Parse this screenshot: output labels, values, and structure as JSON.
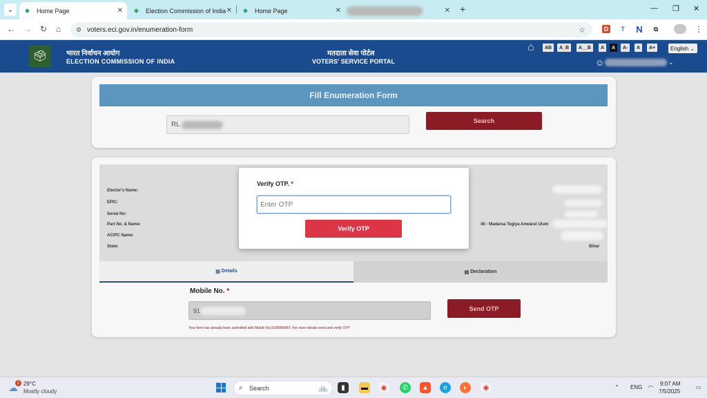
{
  "browser": {
    "tabs": [
      {
        "title": "Home Page",
        "active": true
      },
      {
        "title": "Election Commission of India",
        "active": false
      },
      {
        "title": "Home Page",
        "active": false
      }
    ],
    "url": "voters.eci.gov.in/enumeration-form"
  },
  "site_header": {
    "org_hindi": "भारत निर्वाचन आयोग",
    "org_english": "ELECTION COMMISSION OF INDIA",
    "portal_hindi": "मतदाता सेवा पोर्टल",
    "portal_english": "VOTERS' SERVICE PORTAL",
    "accessibility": [
      "AB",
      "A_B",
      "A__B",
      "A",
      "A",
      "A-",
      "A",
      "A+"
    ],
    "language": "English"
  },
  "form": {
    "title": "Fill Enumeration Form",
    "epic_value": "RL",
    "search_label": "Search",
    "fields": [
      "Elector's Name:",
      "EPIC:",
      "Serial No:",
      "Part No. & Name:",
      "AC/PC Name:",
      "State:"
    ],
    "part_value": "40 - Madarsa Tegiya Anwarul Ulum",
    "state_value": "Bihar",
    "tab_details": "Details",
    "tab_declaration": "Declaration",
    "mobile_label": "Mobile No.",
    "mobile_value": "91",
    "send_otp_label": "Send OTP",
    "message": "Your form has already been submitted with Mobile No.9199085967. For more details send and verify OTP"
  },
  "modal": {
    "label": "Verify OTP.",
    "required_mark": "*",
    "placeholder": "Enter OTP",
    "button_label": "Verify OTP"
  },
  "taskbar": {
    "temperature": "29°C",
    "condition": "Mostly cloudy",
    "weather_badge": "2",
    "search_label": "Search",
    "language": "ENG",
    "time": "9:07 AM",
    "date": "7/5/2025"
  }
}
